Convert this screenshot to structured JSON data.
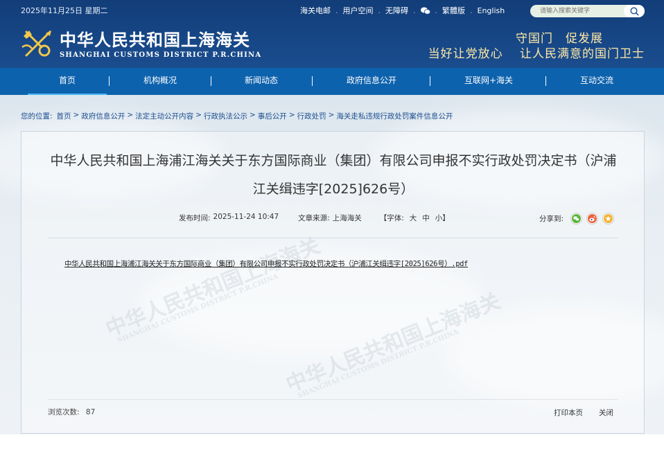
{
  "header": {
    "date": "2025年11月25日 星期二",
    "toplinks": [
      "海关电邮",
      "用户空间",
      "无障碍"
    ],
    "lang_traditional": "繁體版",
    "lang_english": "English",
    "search_placeholder": "请输入搜索关键字",
    "site_title": "中华人民共和国上海海关",
    "site_subtitle": "SHANGHAI CUSTOMS DISTRICT P.R.CHINA",
    "slogan_line1": "守国门　促发展",
    "slogan_line2": "当好让党放心　 让人民满意的国门卫士"
  },
  "nav": {
    "items": [
      "首页",
      "机构概况",
      "新闻动态",
      "政府信息公开",
      "互联网+海关",
      "互动交流"
    ],
    "active": "首页"
  },
  "breadcrumb": {
    "prefix": "您的位置:",
    "items": [
      "首页",
      "政府信息公开",
      "法定主动公开内容",
      "行政执法公示",
      "事后公开",
      "行政处罚",
      "海关走私违规行政处罚案件信息公开"
    ],
    "separator": ">"
  },
  "article": {
    "title": "中华人民共和国上海浦江海关关于东方国际商业（集团）有限公司申报不实行政处罚决定书（沪浦江关缉违字[2025]626号）",
    "publish_label": "发布时间:",
    "publish_time": "2025-11-24 10:47",
    "source_label": "文章来源:",
    "source": "上海海关",
    "font_size_label": "【字体:",
    "font_large": "大",
    "font_medium": "中",
    "font_small": "小",
    "font_size_end": "】",
    "share_label": "分享到:",
    "attachment": "中华人民共和国上海浦江海关关于东方国际商业（集团）有限公司申报不实行政处罚决定书（沪浦江关缉违字[2025]626号）.pdf",
    "views_label": "浏览次数:",
    "views": "87",
    "print_label": "打印本页",
    "close_label": "关闭"
  },
  "watermark": {
    "text_cn": "中华人民共和国上海海关",
    "text_en": "SHANGHAI CUSTOMS DISTRICT P.R.CHINA"
  },
  "colors": {
    "header_bg": "#1a4d8f",
    "nav_bg": "#0d62ad",
    "slogan": "#ffe9a6",
    "link": "#1a4d8f"
  }
}
